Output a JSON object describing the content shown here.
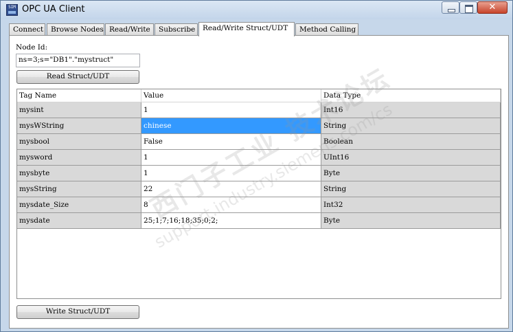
{
  "window": {
    "title": "OPC UA Client",
    "icon_text": "SIM",
    "close_glyph": "✕"
  },
  "tabs": [
    {
      "label": "Connect"
    },
    {
      "label": "Browse Nodes"
    },
    {
      "label": "Read/Write"
    },
    {
      "label": "Subscribe"
    },
    {
      "label": "Read/Write Struct/UDT",
      "active": true
    },
    {
      "label": "Method Calling"
    }
  ],
  "form": {
    "node_id_label": "Node Id:",
    "node_id_value": "ns=3;s=\"DB1\".\"mystruct\"",
    "read_button": "Read Struct/UDT",
    "write_button": "Write Struct/UDT"
  },
  "table": {
    "headers": [
      "Tag Name",
      "Value",
      "Data Type"
    ],
    "rows": [
      {
        "name": "mysint",
        "value": "1",
        "type": "Int16"
      },
      {
        "name": "mysWString",
        "value": "chinese",
        "type": "String",
        "selected": true
      },
      {
        "name": "mysbool",
        "value": "False",
        "type": "Boolean"
      },
      {
        "name": "mysword",
        "value": "1",
        "type": "UInt16"
      },
      {
        "name": "mysbyte",
        "value": "1",
        "type": "Byte"
      },
      {
        "name": "mysString",
        "value": "22",
        "type": "String"
      },
      {
        "name": "mysdate_Size",
        "value": "8",
        "type": "Int32"
      },
      {
        "name": "mysdate",
        "value": "25;1;7;16;18;35;0;2;",
        "type": "Byte"
      }
    ]
  },
  "watermark": {
    "cn": "西门子工业 技术论坛",
    "url": "support.industry.siemens.com/cs"
  },
  "colors": {
    "selection": "#3399ff",
    "readonly_cell": "#d9d9d9"
  }
}
